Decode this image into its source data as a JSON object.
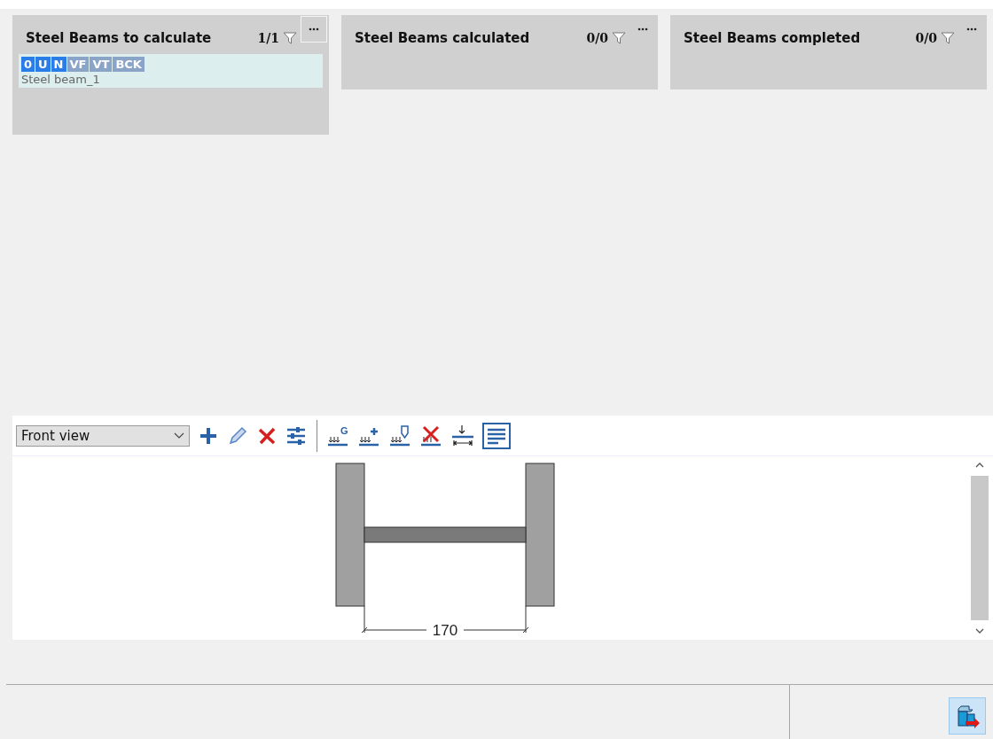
{
  "columns": [
    {
      "title": "Steel Beams to calculate",
      "count": "1/1",
      "menu_focused": true,
      "cards": [
        {
          "tags": [
            {
              "label": "0",
              "active": true
            },
            {
              "label": "U",
              "active": true
            },
            {
              "label": "N",
              "active": true
            },
            {
              "label": "VF",
              "active": false
            },
            {
              "label": "VT",
              "active": false
            },
            {
              "label": "BCK",
              "active": false
            }
          ],
          "name": "Steel beam_1"
        }
      ]
    },
    {
      "title": "Steel Beams calculated",
      "count": "0/0",
      "menu_focused": false
    },
    {
      "title": "Steel Beams completed",
      "count": "0/0",
      "menu_focused": false
    }
  ],
  "view_select": {
    "value": "Front view"
  },
  "toolbar": {
    "load_letter": "G"
  },
  "drawing": {
    "dimension": "170"
  }
}
